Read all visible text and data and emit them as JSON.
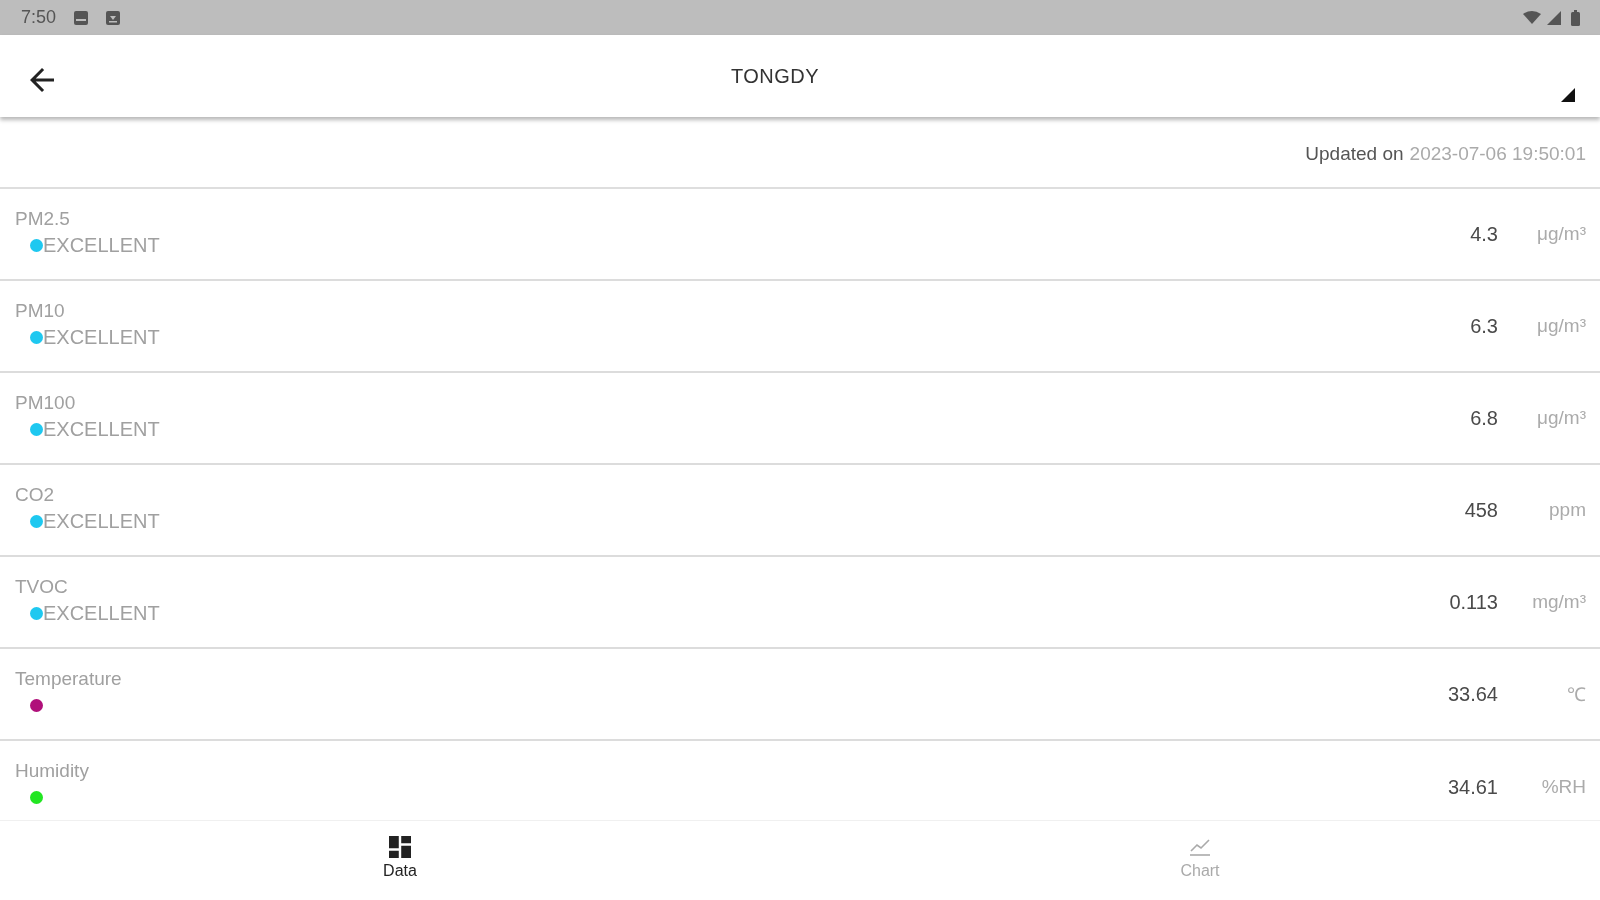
{
  "status_bar": {
    "time": "7:50"
  },
  "app_bar": {
    "title": "TONGDY"
  },
  "updated": {
    "label": "Updated on",
    "timestamp": "2023-07-06 19:50:01"
  },
  "readings": [
    {
      "name": "PM2.5",
      "status": "EXCELLENT",
      "color": "#1ec8f0",
      "value": "4.3",
      "unit": "μg/m³"
    },
    {
      "name": "PM10",
      "status": "EXCELLENT",
      "color": "#1ec8f0",
      "value": "6.3",
      "unit": "μg/m³"
    },
    {
      "name": "PM100",
      "status": "EXCELLENT",
      "color": "#1ec8f0",
      "value": "6.8",
      "unit": "μg/m³"
    },
    {
      "name": "CO2",
      "status": "EXCELLENT",
      "color": "#1ec8f0",
      "value": "458",
      "unit": "ppm"
    },
    {
      "name": "TVOC",
      "status": "EXCELLENT",
      "color": "#1ec8f0",
      "value": "0.113",
      "unit": "mg/m³"
    },
    {
      "name": "Temperature",
      "color": "#b0107a",
      "value": "33.64",
      "unit": "℃"
    },
    {
      "name": "Humidity",
      "color": "#22e622",
      "value": "34.61",
      "unit": "%RH"
    }
  ],
  "bottom_nav": [
    {
      "label": "Data",
      "selected": true
    },
    {
      "label": "Chart",
      "selected": false
    }
  ]
}
